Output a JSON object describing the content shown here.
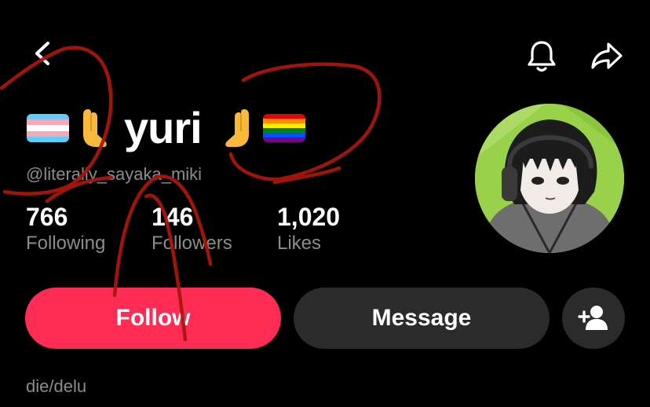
{
  "header": {
    "back_icon": "chevron-left-icon",
    "notify_icon": "bell-icon",
    "share_icon": "share-arrow-icon"
  },
  "profile": {
    "display_name": "yuri",
    "flags": [
      "transgender-pride-flag",
      "rainbow-pride-flag"
    ],
    "emoji": "palms-up-together",
    "handle": "@literally_sayaka_miki",
    "bio": "die/delu"
  },
  "stats": [
    {
      "value": "766",
      "label": "Following"
    },
    {
      "value": "146",
      "label": "Followers"
    },
    {
      "value": "1,020",
      "label": "Likes"
    }
  ],
  "actions": {
    "follow_label": "Follow",
    "message_label": "Message",
    "add_friend_icon": "person-add-icon"
  },
  "colors": {
    "background": "#000000",
    "follow": "#fe2c55",
    "secondary_button": "#2b2b2b",
    "muted_text": "#8c8c8c",
    "scribble": "#a8160c"
  }
}
